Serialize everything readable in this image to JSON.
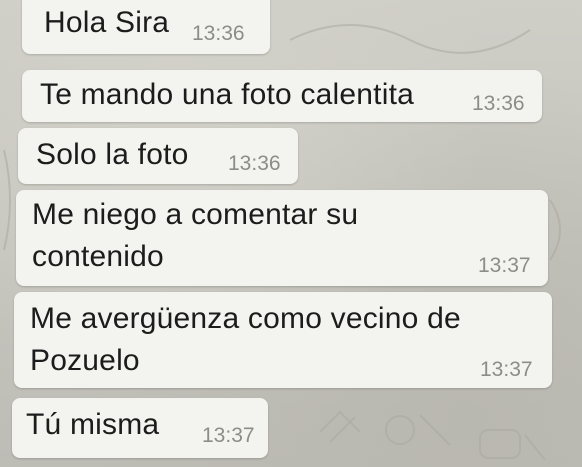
{
  "conversation": {
    "messages": [
      {
        "text": "Hola Sira",
        "time": "13:36"
      },
      {
        "text": "Te mando una foto calentita",
        "time": "13:36"
      },
      {
        "text": "Solo la foto",
        "time": "13:36"
      },
      {
        "text": "Me niego a comentar su contenido",
        "time": "13:37"
      },
      {
        "text": "Me avergüenza como vecino de Pozuelo",
        "time": "13:37"
      },
      {
        "text": "Tú misma",
        "time": "13:37"
      }
    ]
  },
  "theme": {
    "bubble_color": "#f3f3ef",
    "wallpaper_color": "#c8c7c0",
    "text_color": "#1c1c1c",
    "time_color": "#8c8c88"
  }
}
